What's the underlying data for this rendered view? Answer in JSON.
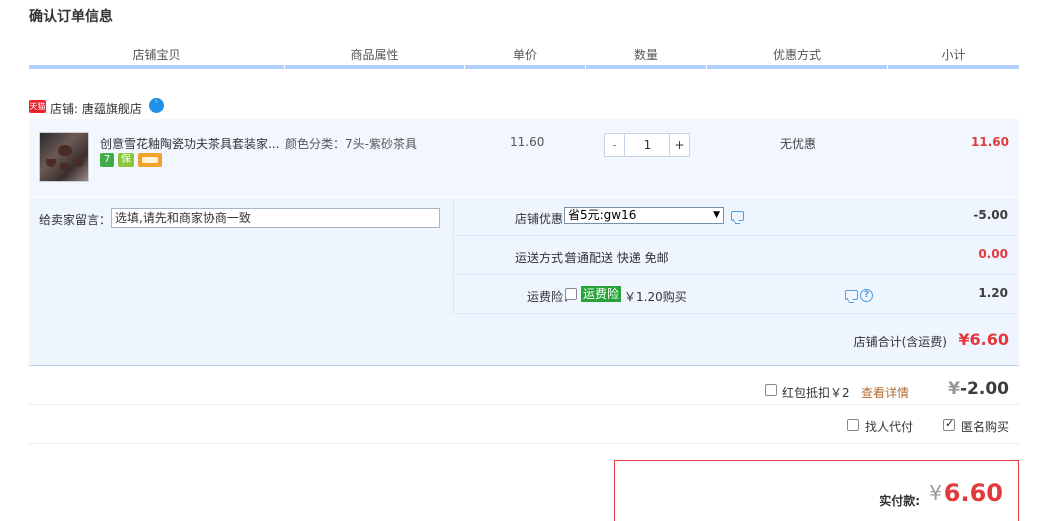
{
  "page": {
    "title": "确认订单信息"
  },
  "table_header": {
    "columns": [
      "店铺宝贝",
      "商品属性",
      "单价",
      "数量",
      "优惠方式",
      "小计"
    ]
  },
  "shop": {
    "badge": "天猫",
    "label": "店铺: 唐蕴旗舰店",
    "ww_icon": "chat-bubble-icon"
  },
  "item": {
    "name": "创意雪花釉陶瓷功夫茶具套装家...",
    "attribute": "颜色分类：7头-紫砂茶具",
    "price": "11.60",
    "quantity": "1",
    "qty_minus": "-",
    "qty_plus": "+",
    "discount": "无优惠",
    "subtotal": "11.60",
    "service_icons": [
      {
        "name": "seven-day-return-icon",
        "text": "7",
        "color": "#4ab44a"
      },
      {
        "name": "guarantee-icon",
        "text": "保",
        "color": "#88c53a"
      },
      {
        "name": "credit-card-icon",
        "text": "",
        "color": "#f3a02c"
      }
    ]
  },
  "details": {
    "message_label": "给卖家留言：",
    "message_value": "选填,请先和商家协商一致",
    "shop_coupon_label": "店铺优惠：",
    "shop_coupon_selected": "省5元:gw16",
    "shop_coupon_amount": "-5.00",
    "shipping_label": "运送方式：",
    "shipping_value": "普通配送 快递 免邮",
    "shipping_amount": "0.00",
    "insurance_label": "运费险：",
    "insurance_tag": "运费险",
    "insurance_text": "￥1.20购买",
    "insurance_amount": "1.20",
    "shop_total_label": "店铺合计(含运费)",
    "shop_total_value": "¥6.60"
  },
  "red_packet": {
    "label": "红包抵扣￥2",
    "link": "查看详情",
    "yen": "¥",
    "amount": "-2.00"
  },
  "options": {
    "proxy_pay": "找人代付",
    "anonymous": "匿名购买"
  },
  "payment": {
    "label": "实付款:",
    "yen": "¥",
    "amount": "6.60"
  },
  "colors": {
    "accent_red": "#e4393c",
    "header_line": "#b2d1ff",
    "row_bg": "#f2f7ff",
    "insurance_green": "#27a33a"
  }
}
